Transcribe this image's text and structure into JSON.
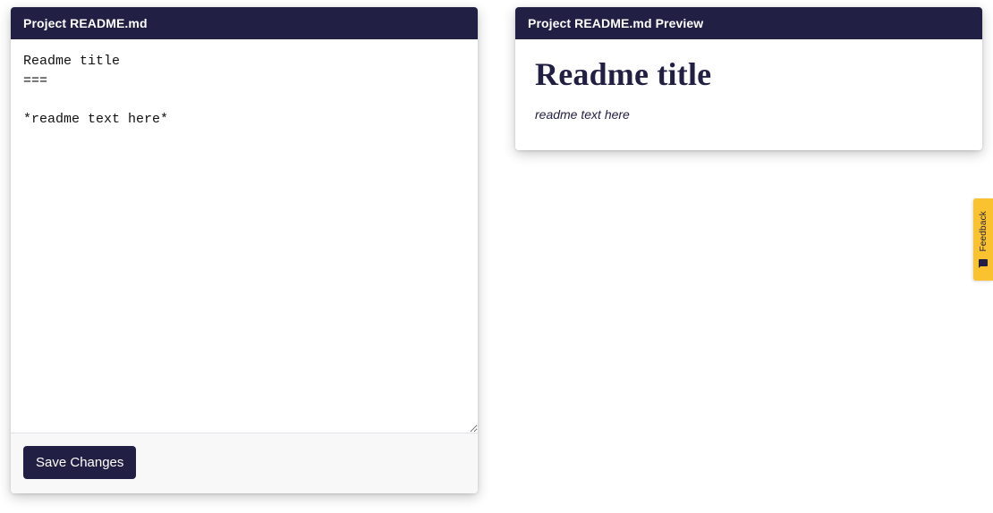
{
  "editor": {
    "header": "Project README.md",
    "content": "Readme title\n===\n\n*readme text here*",
    "save_label": "Save Changes"
  },
  "preview": {
    "header": "Project README.md Preview",
    "title": "Readme title",
    "body": "readme text here"
  },
  "feedback": {
    "label": "Feedback"
  },
  "colors": {
    "header_bg": "#221f44",
    "accent": "#f9c22e"
  }
}
